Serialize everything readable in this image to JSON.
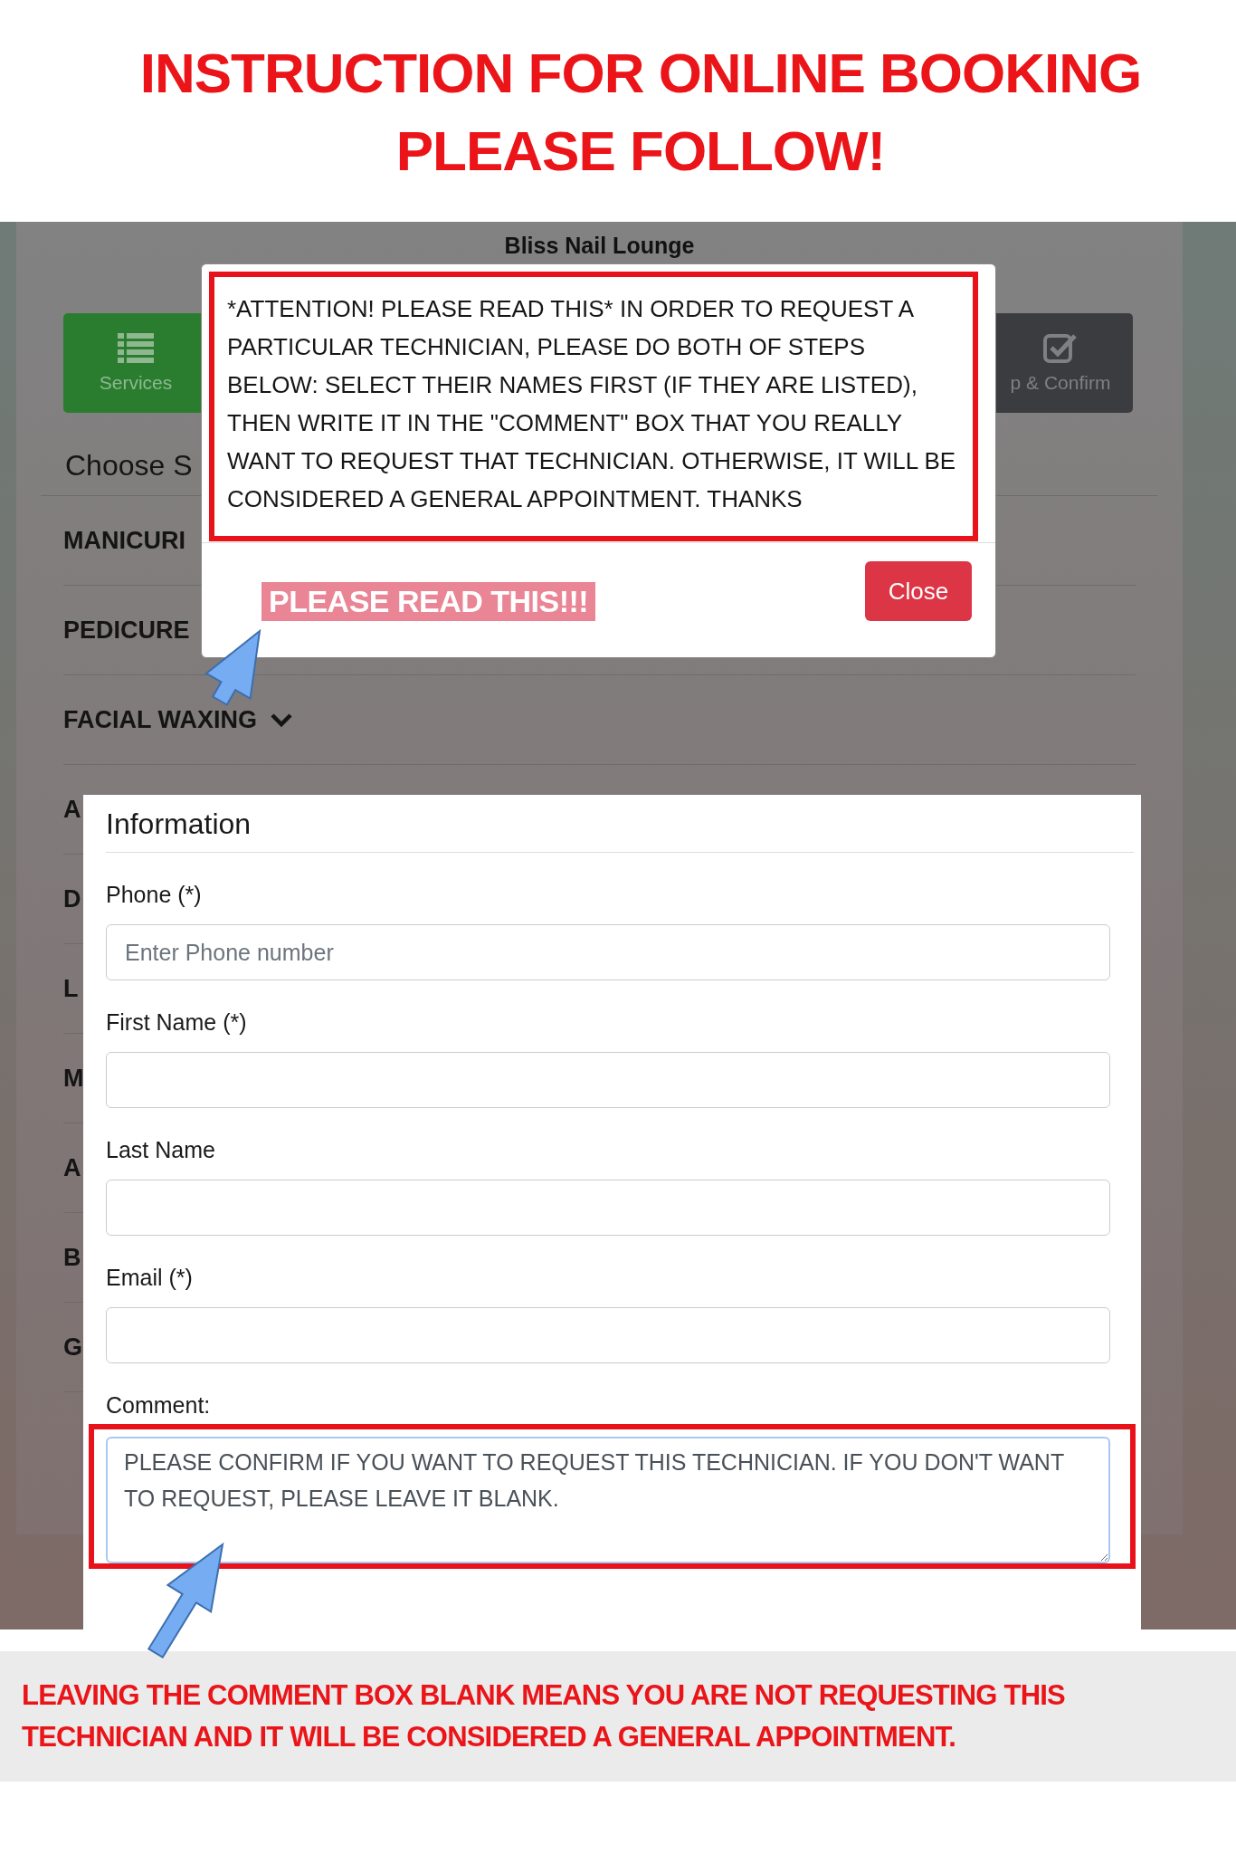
{
  "header": {
    "title_lines": [
      "INSTRUCTION FOR ONLINE BOOKING",
      "PLEASE FOLLOW!"
    ]
  },
  "page": {
    "title": "Bliss Nail Lounge",
    "steps": [
      {
        "label": "Services",
        "selected": true
      },
      {
        "label": "p & Confirm",
        "selected": false
      }
    ],
    "section_title": "Choose S",
    "categories": [
      {
        "label": "MANICURI"
      },
      {
        "label": "PEDICURE"
      },
      {
        "label": "FACIAL WAXING",
        "chevron": true
      },
      {
        "label": "A"
      },
      {
        "label": "D"
      },
      {
        "label": "L"
      },
      {
        "label": "M"
      },
      {
        "label": "A"
      },
      {
        "label": "B"
      },
      {
        "label": "G"
      }
    ]
  },
  "modal": {
    "message": "*ATTENTION! PLEASE READ THIS* IN ORDER TO REQUEST A PARTICULAR TECHNICIAN, PLEASE DO BOTH OF STEPS BELOW: SELECT THEIR NAMES FIRST (IF THEY ARE LISTED), THEN WRITE IT IN THE \"COMMENT\" BOX THAT YOU REALLY WANT TO REQUEST THAT TECHNICIAN. OTHERWISE, IT WILL BE CONSIDERED A GENERAL APPOINTMENT. THANKS",
    "note": "PLEASE READ THIS!!!",
    "close_button": "Close"
  },
  "information": {
    "title": "Information",
    "fields": [
      {
        "label": "Phone (*)",
        "placeholder": "Enter Phone number"
      },
      {
        "label": "First Name (*)"
      },
      {
        "label": "Last Name"
      },
      {
        "label": "Email (*)"
      }
    ],
    "comment": {
      "label": "Comment:",
      "value": "PLEASE CONFIRM IF YOU WANT TO REQUEST THIS TECHNICIAN. IF YOU DON'T WANT TO REQUEST, PLEASE LEAVE IT BLANK."
    }
  },
  "footer_note": "LEAVING THE COMMENT BOX BLANK MEANS YOU ARE NOT REQUESTING THIS TECHNICIAN AND IT WILL BE CONSIDERED A GENERAL APPOINTMENT."
}
